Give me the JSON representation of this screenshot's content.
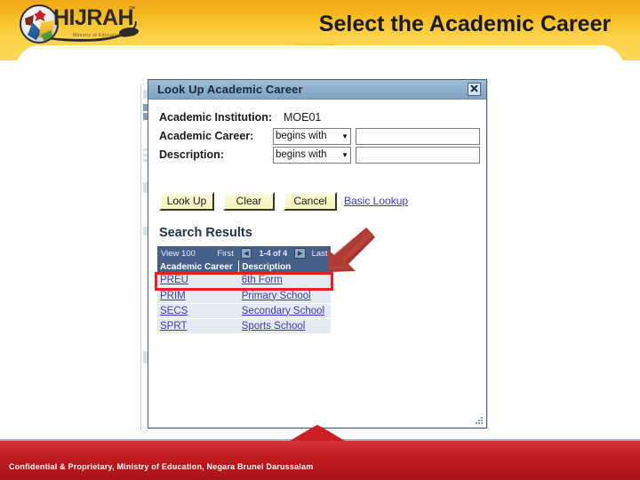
{
  "slide": {
    "title": "Select the Academic Career"
  },
  "brand": {
    "logo_text": "HIJRAH",
    "logo_tm": "™",
    "tagline": "Ministry of Education",
    "logo_icon": "hijrah-emblem-icon"
  },
  "dialog": {
    "title": "Look Up Academic Career",
    "close_label": "✕",
    "close_icon": "close-icon",
    "fields": [
      {
        "label": "Academic Institution:",
        "type": "static",
        "value": "MOE01"
      },
      {
        "label": "Academic Career:",
        "type": "search",
        "operator": "begins with",
        "value": "",
        "placeholder": ""
      },
      {
        "label": "Description:",
        "type": "search",
        "operator": "begins with",
        "value": "",
        "placeholder": ""
      }
    ],
    "operator_caret": "▼",
    "buttons": {
      "look_up": "Look Up",
      "clear": "Clear",
      "cancel": "Cancel"
    },
    "basic_lookup_link": "Basic Lookup",
    "results": {
      "heading": "Search Results",
      "nav": {
        "view": "View 100",
        "first": "First",
        "prev_icon": "◀",
        "range": "1-4 of 4",
        "next_icon": "▶",
        "last": "Last"
      },
      "columns": [
        "Academic Career",
        "Description"
      ],
      "rows": [
        {
          "career": "PREU",
          "description": "6th Form",
          "highlighted": true
        },
        {
          "career": "PRIM",
          "description": "Primary School",
          "highlighted": false
        },
        {
          "career": "SECS",
          "description": "Secondary School",
          "highlighted": false
        },
        {
          "career": "SPRT",
          "description": "Sports School",
          "highlighted": false
        }
      ]
    },
    "resize_grip_icon": "resize-grip-icon"
  },
  "annotation": {
    "arrow_icon": "red-pointer-arrow-icon",
    "highlight_color": "#ee1c1c",
    "arrow_color": "#b23b33"
  },
  "footer": {
    "text": "Confidential & Proprietary, Ministry of Education, Negara Brunei Darussalam"
  },
  "colors": {
    "banner_yellow": "#fbc833",
    "footer_red": "#c21c21",
    "dialog_titlebar": "#8fb0cd",
    "grid_header": "#46608a",
    "link_blue": "#3b3bb3"
  }
}
